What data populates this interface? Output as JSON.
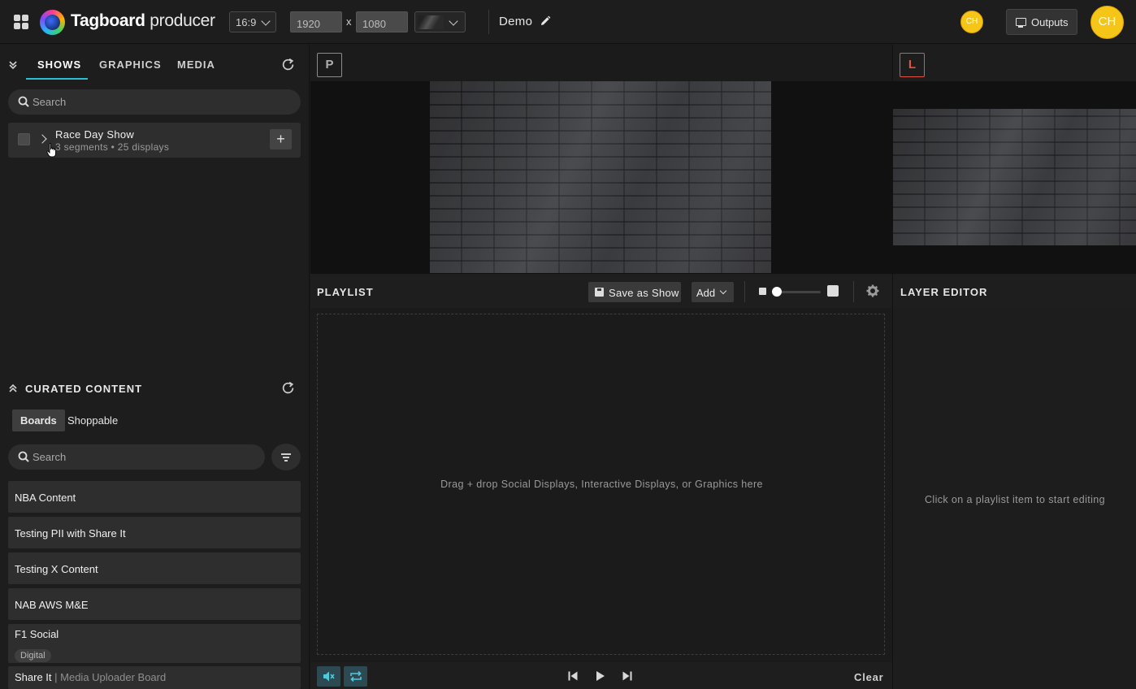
{
  "header": {
    "brand_bold": "Tagboard",
    "brand_light": "producer",
    "aspect_ratio": "16:9",
    "width_value": "1920",
    "dim_separator": "x",
    "height_value": "1080",
    "show_name": "Demo",
    "user_initials_small": "CH",
    "outputs_label": "Outputs",
    "user_initials_large": "CH"
  },
  "left_panel": {
    "tabs": [
      {
        "label": "SHOWS",
        "active": true
      },
      {
        "label": "GRAPHICS",
        "active": false
      },
      {
        "label": "MEDIA",
        "active": false
      }
    ],
    "search_placeholder": "Search",
    "shows": [
      {
        "title": "Race Day Show",
        "meta": "3 segments • 25 displays"
      }
    ],
    "curated": {
      "title": "CURATED CONTENT",
      "tabs": [
        {
          "label": "Boards",
          "active": true
        },
        {
          "label": "Shoppable",
          "active": false
        }
      ],
      "search_placeholder": "Search",
      "boards": [
        {
          "name": "NBA Content"
        },
        {
          "name": "Testing PII with Share It"
        },
        {
          "name": "Testing X Content"
        },
        {
          "name": "NAB AWS M&E"
        },
        {
          "name": "F1 Social",
          "tag": "Digital"
        },
        {
          "name": "Share It",
          "sub": "| Media Uploader Board"
        }
      ]
    }
  },
  "preview": {
    "preview_badge": "P",
    "live_badge": "L"
  },
  "playlist": {
    "title": "PLAYLIST",
    "save_label": "Save as Show",
    "add_label": "Add",
    "drop_hint": "Drag + drop Social Displays, Interactive Displays, or Graphics here",
    "clear_label": "Clear"
  },
  "layer_editor": {
    "title": "LAYER EDITOR",
    "hint": "Click on a playlist item to start editing"
  },
  "colors": {
    "accent": "#2bbfd3",
    "live": "#e0553f",
    "avatar": "#f5c518"
  }
}
